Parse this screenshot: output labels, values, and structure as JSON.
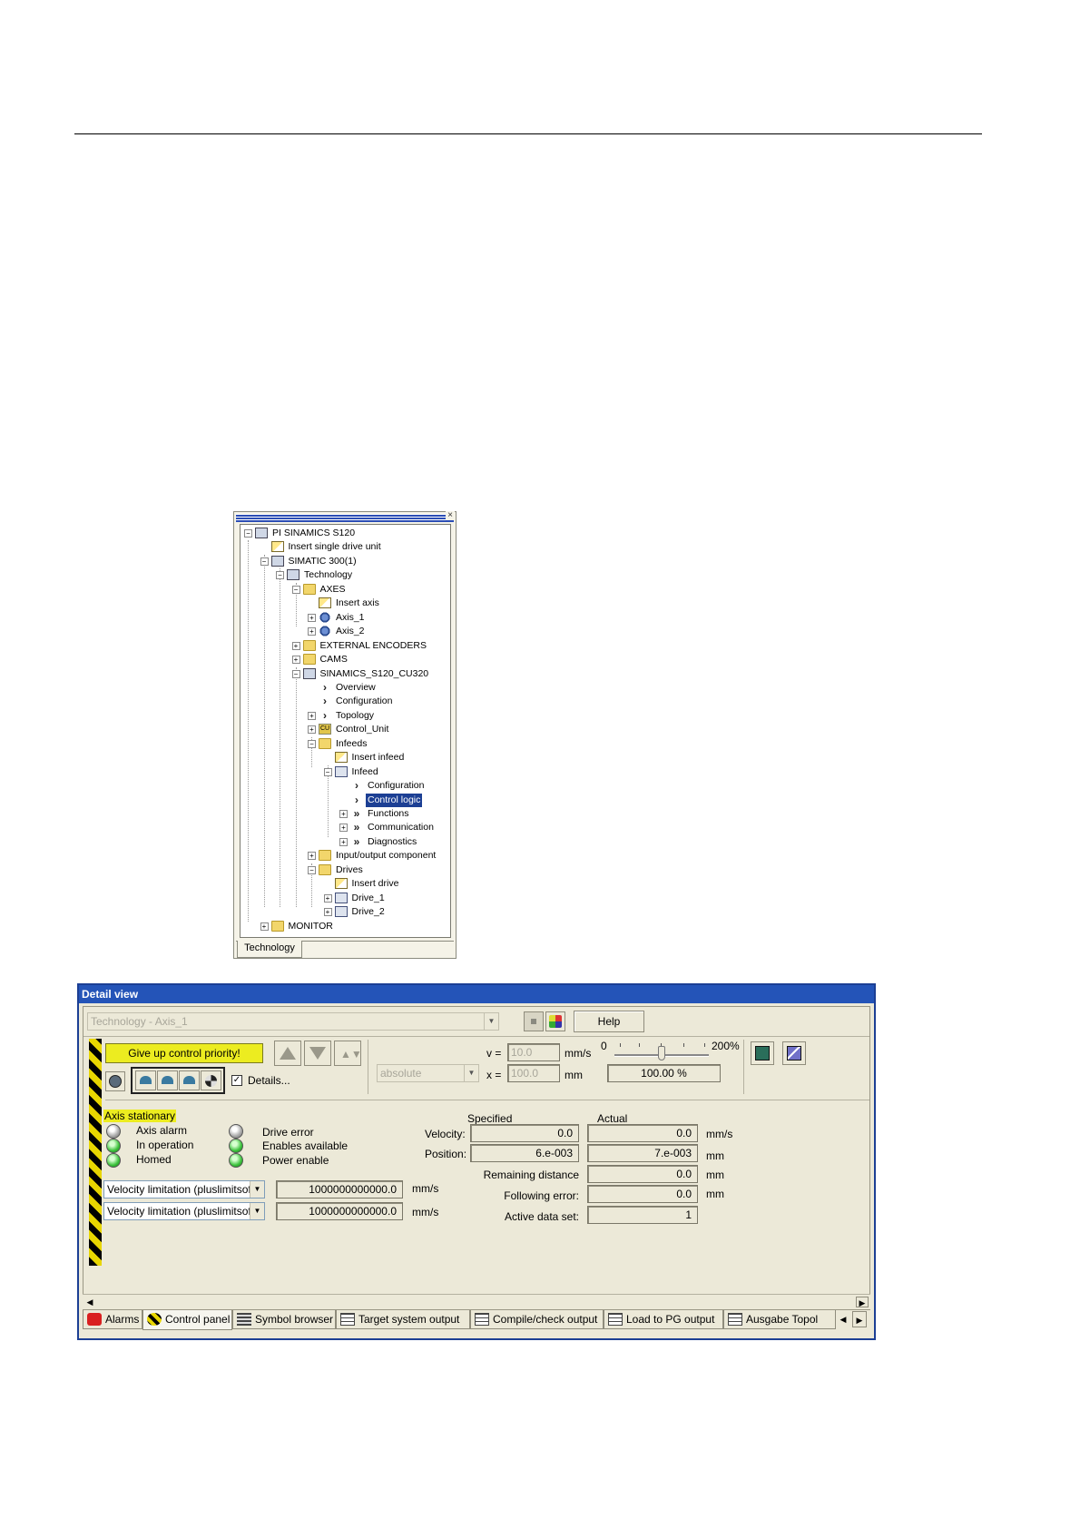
{
  "tree": {
    "items": [
      {
        "label": "PI SINAMICS S120",
        "icon": "project-icon"
      },
      {
        "label": "Insert single drive unit",
        "icon": "insert-icon"
      },
      {
        "label": "SIMATIC 300(1)",
        "icon": "plc-icon"
      },
      {
        "label": "Technology",
        "icon": "technology-icon"
      },
      {
        "label": "AXES",
        "icon": "folder-icon"
      },
      {
        "label": "Insert axis",
        "icon": "insert-icon"
      },
      {
        "label": "Axis_1",
        "icon": "axis-icon"
      },
      {
        "label": "Axis_2",
        "icon": "axis-icon"
      },
      {
        "label": "EXTERNAL ENCODERS",
        "icon": "folder-icon"
      },
      {
        "label": "CAMS",
        "icon": "folder-icon"
      },
      {
        "label": "SINAMICS_S120_CU320",
        "icon": "drive-unit-icon"
      },
      {
        "label": "Overview",
        "icon": "chevron-icon"
      },
      {
        "label": "Configuration",
        "icon": "chevron-icon"
      },
      {
        "label": "Topology",
        "icon": "chevron-icon"
      },
      {
        "label": "Control_Unit",
        "icon": "control-unit-icon"
      },
      {
        "label": "Infeeds",
        "icon": "folder-open-icon"
      },
      {
        "label": "Insert infeed",
        "icon": "insert-icon"
      },
      {
        "label": "Infeed",
        "icon": "infeed-icon"
      },
      {
        "label": "Configuration",
        "icon": "chevron-icon"
      },
      {
        "label": "Control logic",
        "icon": "chevron-icon"
      },
      {
        "label": "Functions",
        "icon": "double-chevron-icon"
      },
      {
        "label": "Communication",
        "icon": "double-chevron-icon"
      },
      {
        "label": "Diagnostics",
        "icon": "double-chevron-icon"
      },
      {
        "label": "Input/output component",
        "icon": "folder-open-icon"
      },
      {
        "label": "Drives",
        "icon": "folder-open-icon"
      },
      {
        "label": "Insert drive",
        "icon": "insert-icon"
      },
      {
        "label": "Drive_1",
        "icon": "drive-icon"
      },
      {
        "label": "Drive_2",
        "icon": "drive-icon"
      },
      {
        "label": "MONITOR",
        "icon": "folder-icon"
      }
    ],
    "tab_label": "Technology",
    "close_glyph": "×"
  },
  "detail": {
    "title": "Detail view",
    "object_select": "Technology - Axis_1",
    "help_label": "Help",
    "give_up_label": "Give up control priority!",
    "details_label": "Details...",
    "details_checked": "✓",
    "mode_select": "absolute",
    "v_label": "v =",
    "v_value": "10.0",
    "v_unit": "mm/s",
    "x_label": "x =",
    "x_value": "100.0",
    "x_unit": "mm",
    "override_min": "0",
    "override_max": "200%",
    "override_value": "100.00 %",
    "status": "Axis stationary",
    "lamps": [
      {
        "label": "Axis alarm",
        "state": "off"
      },
      {
        "label": "In operation",
        "state": "on"
      },
      {
        "label": "Homed",
        "state": "on"
      },
      {
        "label": "Drive error",
        "state": "off"
      },
      {
        "label": "Enables available",
        "state": "on"
      },
      {
        "label": "Power enable",
        "state": "on"
      }
    ],
    "limits": [
      {
        "select": "Velocity limitation (pluslimitsofdyn",
        "value": "1000000000000.0",
        "unit": "mm/s"
      },
      {
        "select": "Velocity limitation (pluslimitsofdyn",
        "value": "1000000000000.0",
        "unit": "mm/s"
      }
    ],
    "col_specified": "Specified",
    "col_actual": "Actual",
    "rows": [
      {
        "label": "Velocity:",
        "specified": "0.0",
        "actual": "0.0",
        "unit": "mm/s"
      },
      {
        "label": "Position:",
        "specified": "6.e-003",
        "actual": "7.e-003",
        "unit": "mm"
      },
      {
        "label": "Remaining distance",
        "actual": "0.0",
        "unit": "mm"
      },
      {
        "label": "Following error:",
        "actual": "0.0",
        "unit": "mm"
      },
      {
        "label": "Active data set:",
        "actual": "1"
      }
    ],
    "tabs": [
      "Alarms",
      "Control panel",
      "Symbol browser",
      "Target system output",
      "Compile/check output",
      "Load to PG output",
      "Ausgabe Topol"
    ],
    "active_tab": "Control panel",
    "colors": {
      "title_bar": "#2454b8",
      "highlight": "#ecec20",
      "selection": "#1c3f94"
    }
  }
}
